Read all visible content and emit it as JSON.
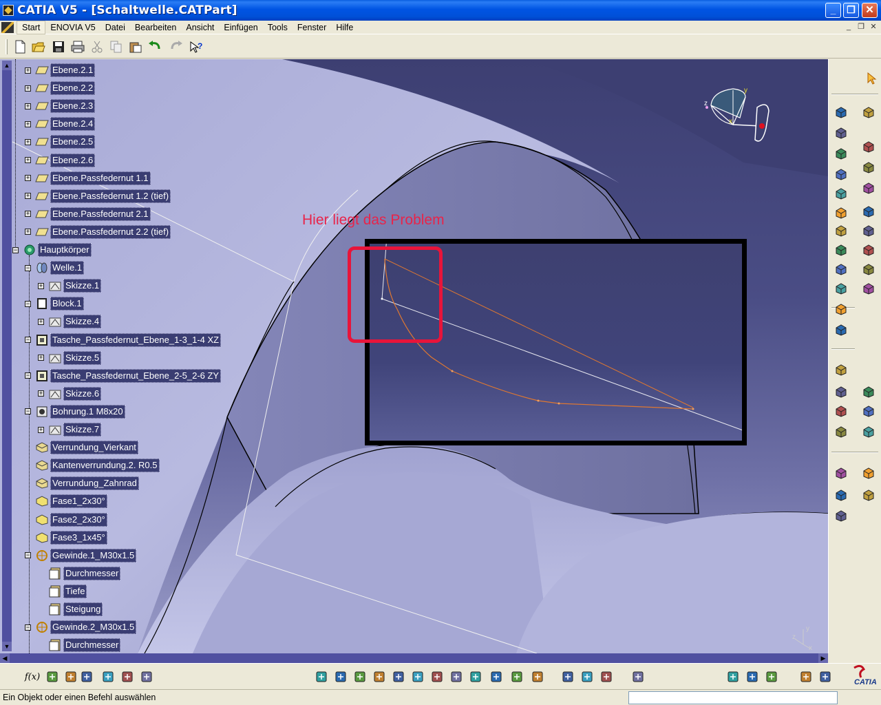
{
  "window": {
    "title": "CATIA V5 - [Schaltwelle.CATPart]",
    "minimize": "_",
    "maximize": "❐",
    "close": "✕"
  },
  "menubar": {
    "items": [
      "Start",
      "ENOVIA V5",
      "Datei",
      "Bearbeiten",
      "Ansicht",
      "Einfügen",
      "Tools",
      "Fenster",
      "Hilfe"
    ],
    "mdi_controls": [
      "_",
      "❐",
      "✕"
    ]
  },
  "toolbar_top": {
    "icons": [
      "new-icon",
      "open-icon",
      "save-icon",
      "print-icon",
      "cut-icon",
      "copy-icon",
      "paste-icon",
      "undo-icon",
      "redo-icon",
      "whats-this-icon"
    ]
  },
  "tree": {
    "nodes": [
      {
        "label": "Ebene.2.1",
        "icon": "plane-icon",
        "level": 1,
        "expander": "+"
      },
      {
        "label": "Ebene.2.2",
        "icon": "plane-icon",
        "level": 1,
        "expander": "+"
      },
      {
        "label": "Ebene.2.3",
        "icon": "plane-icon",
        "level": 1,
        "expander": "+"
      },
      {
        "label": "Ebene.2.4",
        "icon": "plane-icon",
        "level": 1,
        "expander": "+"
      },
      {
        "label": "Ebene.2.5",
        "icon": "plane-icon",
        "level": 1,
        "expander": "+"
      },
      {
        "label": "Ebene.2.6",
        "icon": "plane-icon",
        "level": 1,
        "expander": "+"
      },
      {
        "label": "Ebene.Passfedernut 1.1",
        "icon": "plane-icon",
        "level": 1,
        "expander": "+"
      },
      {
        "label": "Ebene.Passfedernut 1.2 (tief)",
        "icon": "plane-icon",
        "level": 1,
        "expander": "+"
      },
      {
        "label": "Ebene.Passfedernut 2.1",
        "icon": "plane-icon",
        "level": 1,
        "expander": "+"
      },
      {
        "label": "Ebene.Passfedernut 2.2 (tief)",
        "icon": "plane-icon",
        "level": 1,
        "expander": "+"
      },
      {
        "label": "Hauptkörper",
        "icon": "body-gear-icon",
        "level": 0,
        "expander": "−"
      },
      {
        "label": "Welle.1",
        "icon": "shaft-icon",
        "level": 1,
        "expander": "−"
      },
      {
        "label": "Skizze.1",
        "icon": "sketch-icon",
        "level": 2,
        "expander": "+"
      },
      {
        "label": "Block.1",
        "icon": "pad-icon",
        "level": 1,
        "expander": "−"
      },
      {
        "label": "Skizze.4",
        "icon": "sketch-icon",
        "level": 2,
        "expander": "+"
      },
      {
        "label": "Tasche_Passfedernut_Ebene_1-3_1-4 XZ",
        "icon": "pocket-icon",
        "level": 1,
        "expander": "−"
      },
      {
        "label": "Skizze.5",
        "icon": "sketch-icon",
        "level": 2,
        "expander": "+"
      },
      {
        "label": "Tasche_Passfedernut_Ebene_2-5_2-6 ZY",
        "icon": "pocket-icon",
        "level": 1,
        "expander": "−"
      },
      {
        "label": "Skizze.6",
        "icon": "sketch-icon",
        "level": 2,
        "expander": "+"
      },
      {
        "label": "Bohrung.1 M8x20",
        "icon": "hole-icon",
        "level": 1,
        "expander": "−"
      },
      {
        "label": "Skizze.7",
        "icon": "sketch-icon",
        "level": 2,
        "expander": "+"
      },
      {
        "label": "Verrundung_Vierkant",
        "icon": "fillet-icon",
        "level": 1,
        "expander": ""
      },
      {
        "label": "Kantenverrundung.2. R0.5",
        "icon": "fillet-icon",
        "level": 1,
        "expander": ""
      },
      {
        "label": "Verrundung_Zahnrad",
        "icon": "fillet-icon",
        "level": 1,
        "expander": ""
      },
      {
        "label": "Fase1_2x30°",
        "icon": "chamfer-icon",
        "level": 1,
        "expander": ""
      },
      {
        "label": "Fase2_2x30°",
        "icon": "chamfer-icon",
        "level": 1,
        "expander": ""
      },
      {
        "label": "Fase3_1x45°",
        "icon": "chamfer-icon",
        "level": 1,
        "expander": ""
      },
      {
        "label": "Gewinde.1_M30x1.5",
        "icon": "thread-icon",
        "level": 1,
        "expander": "−"
      },
      {
        "label": "Durchmesser",
        "icon": "parameter-icon",
        "level": 2,
        "expander": ""
      },
      {
        "label": "Tiefe",
        "icon": "parameter-icon",
        "level": 2,
        "expander": ""
      },
      {
        "label": "Steigung",
        "icon": "parameter-icon",
        "level": 2,
        "expander": ""
      },
      {
        "label": "Gewinde.2_M30x1.5",
        "icon": "thread-icon",
        "level": 1,
        "expander": "−"
      },
      {
        "label": "Durchmesser",
        "icon": "parameter-icon",
        "level": 2,
        "expander": ""
      }
    ]
  },
  "annotation": {
    "text": "Hier liegt das Problem",
    "color": "#e8244a"
  },
  "compass": {
    "x": "x",
    "y": "y",
    "z": "z"
  },
  "axis_small": {
    "x": "x",
    "y": "y",
    "z": "z"
  },
  "toolbar_right": {
    "icons": [
      "select-arrow-icon",
      "sketcher-icon",
      "pad-icon",
      "pocket-icon",
      "shaft-icon",
      "groove-icon",
      "hole-icon",
      "rib-icon",
      "slot-icon",
      "stiffener-icon",
      "loft-icon",
      "remove-loft-icon",
      "split-icon",
      "constraint-icon",
      "point-icon",
      "line-icon",
      "plane-icon",
      "apply-material-icon",
      "measure-icon",
      "mirror-icon",
      "pattern-icon",
      "scale-icon",
      "fillet-icon",
      "chamfer-icon",
      "draft-icon",
      "shell-icon",
      "thickness-icon",
      "thread-icon",
      "add-body-icon",
      "boolean-icon",
      "annotation-text-icon",
      "analysis-icon",
      "hide-show-icon",
      "swap-icon"
    ]
  },
  "toolbar_bottom": {
    "icons": [
      "formula-icon",
      "comment-icon",
      "knowledge-icon",
      "table-icon",
      "tree-expand-icon",
      "lock-icon",
      "catalog-icon",
      "fly-mode-icon",
      "fit-all-icon",
      "pan-icon",
      "rotate-icon",
      "zoom-in-icon",
      "zoom-out-icon",
      "normal-view-icon",
      "quick-view-icon",
      "iso-view-icon",
      "render-style-icon",
      "shading-icon",
      "hide-icon",
      "swap-space-icon",
      "material-icon",
      "lightbulb-icon",
      "update-icon",
      "sketch-analysis-icon",
      "measure-between-icon",
      "measure-item-icon",
      "cycle-icon",
      "axis-system-icon"
    ],
    "formula_label": "f(x)"
  },
  "status": {
    "message": "Ein Objekt oder einen Befehl auswählen",
    "command_value": ""
  },
  "logo": {
    "text": "CATIA"
  },
  "colors": {
    "title_bar": "#0054e3",
    "tree_label_bg": "#3a3d72",
    "background_top": "#3d3f72",
    "highlight_red": "#e8143a",
    "curve_orange": "#e07830"
  }
}
